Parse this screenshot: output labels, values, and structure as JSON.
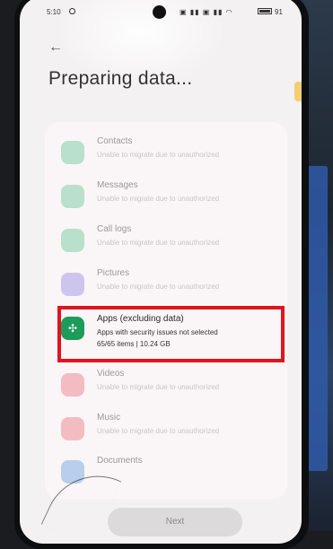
{
  "status_bar": {
    "time": "5:10",
    "signal_text": "▣ ▮▮ ▣ ▮▮ ◠",
    "battery": "91"
  },
  "page": {
    "title": "Preparing data..."
  },
  "items": [
    {
      "name": "Contacts",
      "sub": "Unable to migrate due to unauthorized"
    },
    {
      "name": "Messages",
      "sub": "Unable to migrate due to unauthorized"
    },
    {
      "name": "Call logs",
      "sub": "Unable to migrate due to unauthorized"
    },
    {
      "name": "Pictures",
      "sub": "Unable to migrate due to unauthorized"
    },
    {
      "name": "Videos",
      "sub": "Unable to migrate due to unauthorized"
    },
    {
      "name": "Music",
      "sub": "Unable to migrate due to unauthorized"
    },
    {
      "name": "Documents",
      "sub": ""
    }
  ],
  "apps": {
    "name": "Apps (excluding data)",
    "sub": "Apps with security issues not selected",
    "meta": "65/65 items | 10.24 GB"
  },
  "next_label": "Next",
  "colors": {
    "highlight": "#e0141f",
    "apps_icon": "#1c9c5a"
  }
}
